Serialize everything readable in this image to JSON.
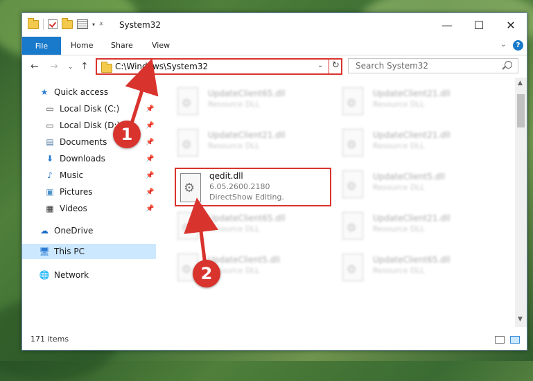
{
  "window": {
    "title": "System32",
    "minimize_glyph": "—",
    "maximize_glyph": "☐",
    "close_glyph": "✕"
  },
  "ribbon": {
    "tabs": [
      "File",
      "Home",
      "Share",
      "View"
    ],
    "help_label": "?"
  },
  "nav": {
    "address": "C:\\Windows\\System32",
    "search_placeholder": "Search System32"
  },
  "sidebar": {
    "items": [
      {
        "label": "Quick access",
        "icon": "star-icon",
        "pinned": false
      },
      {
        "label": "Local Disk (C:)",
        "icon": "drive-icon",
        "pinned": true
      },
      {
        "label": "Local Disk (D:)",
        "icon": "drive-icon",
        "pinned": true
      },
      {
        "label": "Documents",
        "icon": "document-icon",
        "pinned": true
      },
      {
        "label": "Downloads",
        "icon": "download-icon",
        "pinned": true
      },
      {
        "label": "Music",
        "icon": "music-icon",
        "pinned": true
      },
      {
        "label": "Pictures",
        "icon": "pictures-icon",
        "pinned": true
      },
      {
        "label": "Videos",
        "icon": "videos-icon",
        "pinned": true
      },
      {
        "label": "OneDrive",
        "icon": "cloud-icon",
        "pinned": false
      },
      {
        "label": "This PC",
        "icon": "computer-icon",
        "pinned": false,
        "selected": true
      },
      {
        "label": "Network",
        "icon": "network-icon",
        "pinned": false
      }
    ]
  },
  "files": {
    "blurred": [
      {
        "name": "UpdateClient65.dll",
        "type": "Resource DLL"
      },
      {
        "name": "UpdateClient21.dll",
        "type": "Resource DLL"
      },
      {
        "name": "UpdateClient21.dll",
        "type": "Resource DLL"
      },
      {
        "name": "UpdateClient21.dll",
        "type": "Resource DLL"
      },
      {
        "name": "UpdateClient5.dll",
        "type": "Resource DLL"
      },
      {
        "name": "UpdateClient65.dll",
        "type": "Resource DLL"
      },
      {
        "name": "UpdateClient21.dll",
        "type": "Resource DLL"
      },
      {
        "name": "UpdateClient5.dll",
        "type": "Resource DLL"
      },
      {
        "name": "UpdateClient65.dll",
        "type": "Resource DLL"
      }
    ],
    "highlighted": {
      "name": "qedit.dll",
      "version": "6.05.2600.2180",
      "description": "DirectShow Editing."
    }
  },
  "status": {
    "items_count": "171 items"
  },
  "annotations": {
    "step1": "1",
    "step2": "2",
    "highlight_color": "#d9332e"
  }
}
